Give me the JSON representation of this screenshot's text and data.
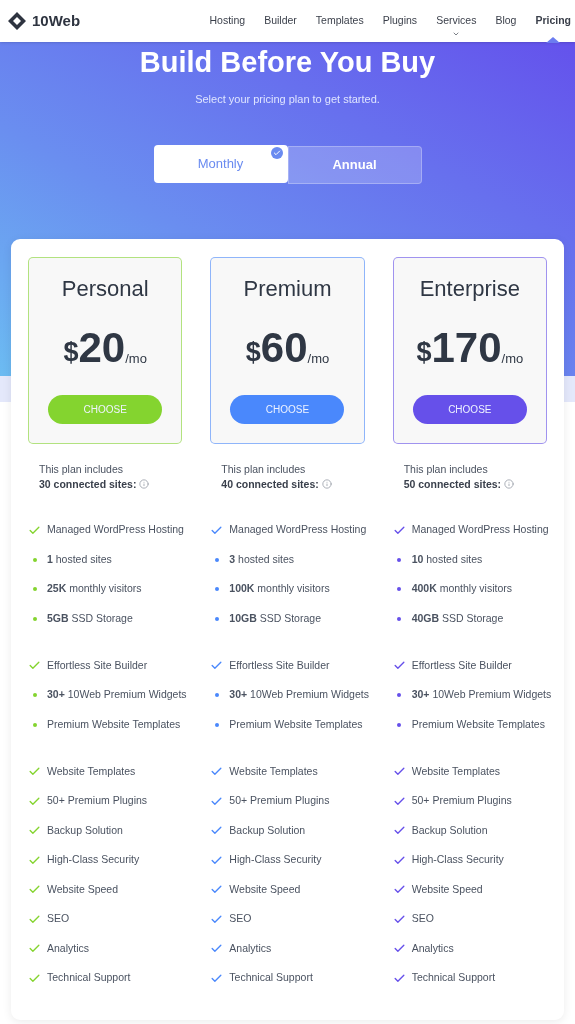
{
  "brand": {
    "name": "10Web"
  },
  "nav": [
    {
      "label": "Hosting",
      "selected": false,
      "has_dropdown": false
    },
    {
      "label": "Builder",
      "selected": false,
      "has_dropdown": false
    },
    {
      "label": "Templates",
      "selected": false,
      "has_dropdown": false
    },
    {
      "label": "Plugins",
      "selected": false,
      "has_dropdown": false
    },
    {
      "label": "Services",
      "selected": false,
      "has_dropdown": true
    },
    {
      "label": "Blog",
      "selected": false,
      "has_dropdown": false
    },
    {
      "label": "Pricing",
      "selected": true,
      "has_dropdown": false
    }
  ],
  "hero": {
    "title": "Build Before You Buy",
    "subtitle": "Select your pricing plan to get started."
  },
  "billing_toggle": [
    {
      "label": "Monthly",
      "selected": true
    },
    {
      "label": "Annual",
      "selected": false
    }
  ],
  "plans": [
    {
      "name": "Personal",
      "color": "#84d42f",
      "currency": "$",
      "amount": "20",
      "period": "/mo",
      "button": "CHOOSE",
      "includes": "This plan includes",
      "sites": "30 connected sites:",
      "feature_groups": [
        [
          {
            "kind": "check",
            "text": "Managed WordPress Hosting"
          },
          {
            "kind": "bullet",
            "text": "**1** hosted sites"
          },
          {
            "kind": "bullet",
            "text": "**25K** monthly visitors"
          },
          {
            "kind": "bullet",
            "text": "**5GB** SSD Storage"
          }
        ],
        [
          {
            "kind": "check",
            "text": "Effortless Site Builder"
          },
          {
            "kind": "bullet",
            "text": "**30+** 10Web Premium Widgets"
          },
          {
            "kind": "bullet",
            "text": "Premium Website Templates"
          }
        ],
        [
          {
            "kind": "check",
            "text": "Website Templates"
          },
          {
            "kind": "check",
            "text": "50+ Premium Plugins"
          },
          {
            "kind": "check",
            "text": "Backup Solution"
          },
          {
            "kind": "check",
            "text": "High-Class Security"
          },
          {
            "kind": "check",
            "text": "Website Speed"
          },
          {
            "kind": "check",
            "text": "SEO"
          },
          {
            "kind": "check",
            "text": "Analytics"
          },
          {
            "kind": "check",
            "text": "Technical Support"
          }
        ]
      ]
    },
    {
      "name": "Premium",
      "color": "#4a88fc",
      "currency": "$",
      "amount": "60",
      "period": "/mo",
      "button": "CHOOSE",
      "includes": "This plan includes",
      "sites": "40 connected sites:",
      "feature_groups": [
        [
          {
            "kind": "check",
            "text": "Managed WordPress Hosting"
          },
          {
            "kind": "bullet",
            "text": "**3** hosted sites"
          },
          {
            "kind": "bullet",
            "text": "**100K** monthly visitors"
          },
          {
            "kind": "bullet",
            "text": "**10GB** SSD Storage"
          }
        ],
        [
          {
            "kind": "check",
            "text": "Effortless Site Builder"
          },
          {
            "kind": "bullet",
            "text": "**30+** 10Web Premium Widgets"
          },
          {
            "kind": "bullet",
            "text": "Premium Website Templates"
          }
        ],
        [
          {
            "kind": "check",
            "text": "Website Templates"
          },
          {
            "kind": "check",
            "text": "50+ Premium Plugins"
          },
          {
            "kind": "check",
            "text": "Backup Solution"
          },
          {
            "kind": "check",
            "text": "High-Class Security"
          },
          {
            "kind": "check",
            "text": "Website Speed"
          },
          {
            "kind": "check",
            "text": "SEO"
          },
          {
            "kind": "check",
            "text": "Analytics"
          },
          {
            "kind": "check",
            "text": "Technical Support"
          }
        ]
      ]
    },
    {
      "name": "Enterprise",
      "color": "#6650ea",
      "currency": "$",
      "amount": "170",
      "period": "/mo",
      "button": "CHOOSE",
      "includes": "This plan includes",
      "sites": "50 connected sites:",
      "feature_groups": [
        [
          {
            "kind": "check",
            "text": "Managed WordPress Hosting"
          },
          {
            "kind": "bullet",
            "text": "**10** hosted sites"
          },
          {
            "kind": "bullet",
            "text": "**400K** monthly visitors"
          },
          {
            "kind": "bullet",
            "text": "**40GB** SSD Storage"
          }
        ],
        [
          {
            "kind": "check",
            "text": "Effortless Site Builder"
          },
          {
            "kind": "bullet",
            "text": "**30+** 10Web Premium Widgets"
          },
          {
            "kind": "bullet",
            "text": "Premium Website Templates"
          }
        ],
        [
          {
            "kind": "check",
            "text": "Website Templates"
          },
          {
            "kind": "check",
            "text": "50+ Premium Plugins"
          },
          {
            "kind": "check",
            "text": "Backup Solution"
          },
          {
            "kind": "check",
            "text": "High-Class Security"
          },
          {
            "kind": "check",
            "text": "Website Speed"
          },
          {
            "kind": "check",
            "text": "SEO"
          },
          {
            "kind": "check",
            "text": "Analytics"
          },
          {
            "kind": "check",
            "text": "Technical Support"
          }
        ]
      ]
    }
  ]
}
